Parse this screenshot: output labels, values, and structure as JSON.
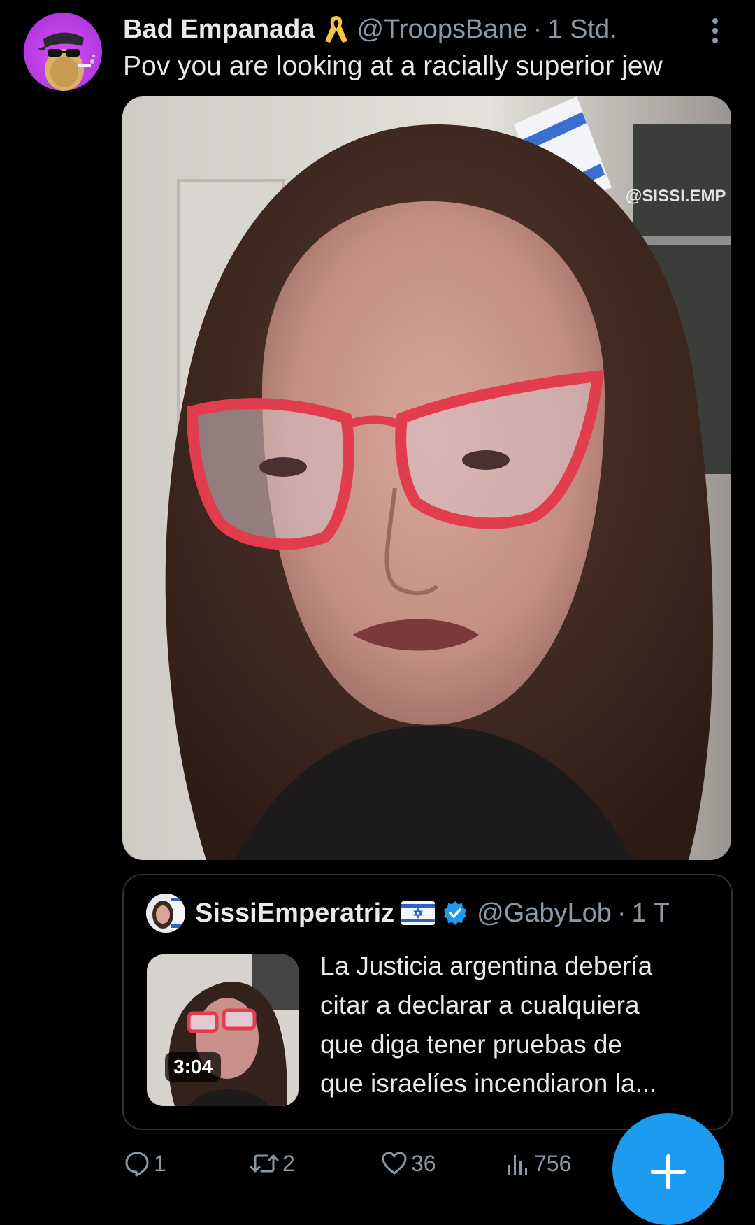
{
  "tweet": {
    "display_name": "Bad Empanada",
    "handle": "@TroopsBane",
    "separator": "·",
    "time": "1 Std.",
    "text": "Pov you are looking at a racially superior jew",
    "media": {
      "watermark": "@SISSI.EMP"
    }
  },
  "quote": {
    "display_name": "SissiEmperatriz",
    "handle": "@GabyLob",
    "separator": "·",
    "time": "1 T",
    "video_duration": "3:04",
    "text_lines": [
      "La Justicia argentina debería",
      "citar a declarar a cualquiera",
      "que diga tener pruebas de",
      "que israelíes incendiaron la..."
    ]
  },
  "actions": {
    "reply_count": "1",
    "retweet_count": "2",
    "like_count": "36",
    "views_count": "756"
  },
  "icons": {
    "more": "more-vertical-icon",
    "ribbon": "yellow-ribbon-icon",
    "flag": "israel-flag-icon",
    "verified": "verified-badge-icon",
    "reply": "reply-icon",
    "retweet": "retweet-icon",
    "like": "heart-icon",
    "views": "views-icon",
    "compose": "plus-icon"
  },
  "colors": {
    "background": "#000000",
    "text": "#e7e9ea",
    "secondary_text": "#8b98a5",
    "border": "#2f3336",
    "accent": "#1d9bf0",
    "avatar_bg": "#b13ae0",
    "ribbon": "#f4c542"
  }
}
